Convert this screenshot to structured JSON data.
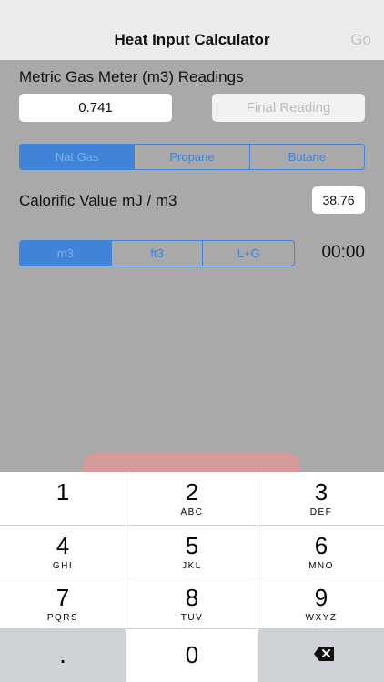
{
  "navbar": {
    "title": "Heat Input Calculator",
    "go_label": "Go"
  },
  "meter": {
    "section_label": "Metric Gas Meter (m3) Readings",
    "initial_value": "0.741",
    "final_placeholder": "Final Reading"
  },
  "gas_types": {
    "options": [
      "Nat Gas",
      "Propane",
      "Butane"
    ],
    "selected": "Nat Gas"
  },
  "calorific": {
    "label": "Calorific Value mJ / m3",
    "value": "38.76"
  },
  "units": {
    "options": [
      "m3",
      "ft3",
      "L+G"
    ],
    "selected": "m3"
  },
  "timer": {
    "value": "00:00"
  },
  "keypad": {
    "keys": [
      {
        "digit": "1",
        "letters": ""
      },
      {
        "digit": "2",
        "letters": "ABC"
      },
      {
        "digit": "3",
        "letters": "DEF"
      },
      {
        "digit": "4",
        "letters": "GHI"
      },
      {
        "digit": "5",
        "letters": "JKL"
      },
      {
        "digit": "6",
        "letters": "MNO"
      },
      {
        "digit": "7",
        "letters": "PQRS"
      },
      {
        "digit": "8",
        "letters": "TUV"
      },
      {
        "digit": "9",
        "letters": "WXYZ"
      }
    ],
    "decimal": ".",
    "zero": "0",
    "delete_icon": "backspace-icon"
  },
  "colors": {
    "accent": "#3f84d8",
    "background_dim": "#a9a9a9",
    "navbar": "#ececec",
    "button_red": "#d69a9a"
  }
}
